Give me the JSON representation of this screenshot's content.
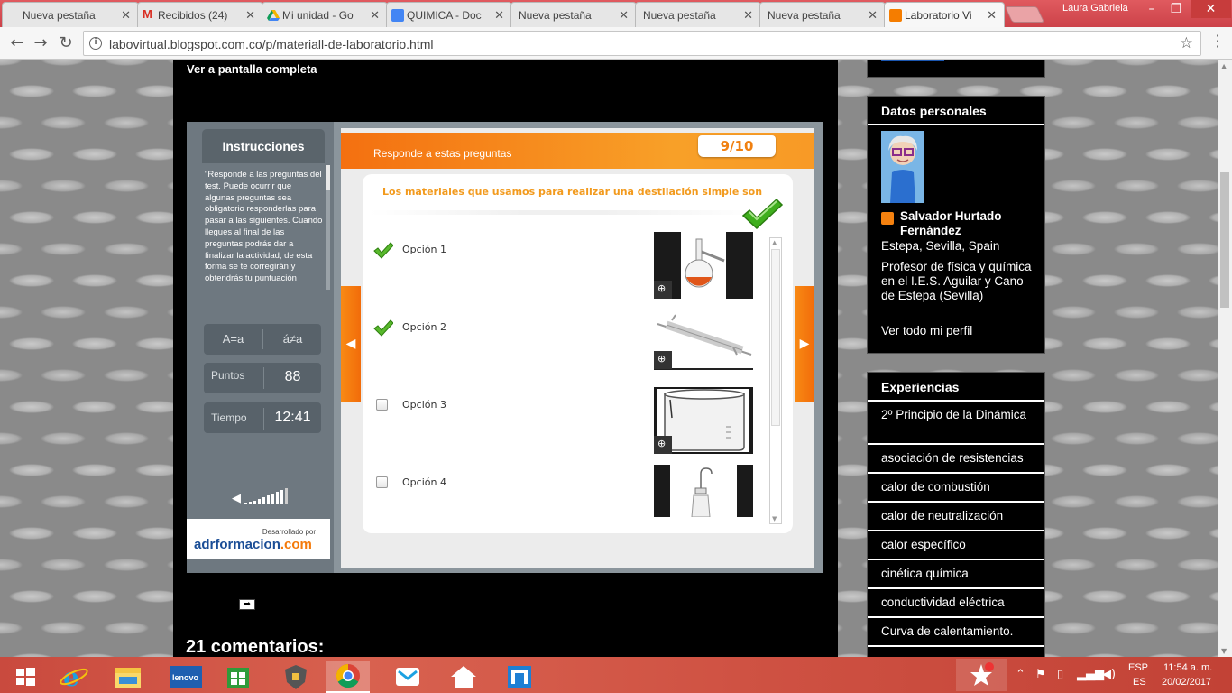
{
  "browser": {
    "tabs": [
      {
        "label": "Nueva pestaña",
        "icon": "blank-page-icon",
        "color": "#ffffff"
      },
      {
        "label": "Recibidos (24)",
        "icon": "gmail-icon",
        "color": "#d93025"
      },
      {
        "label": "Mi unidad - Go",
        "icon": "google-drive-icon",
        "color": "#f4b400"
      },
      {
        "label": "QUIMICA - Doc",
        "icon": "google-docs-icon",
        "color": "#4285f4"
      },
      {
        "label": "Nueva pestaña",
        "icon": "blank-page-icon",
        "color": "#ffffff"
      },
      {
        "label": "Nueva pestaña",
        "icon": "blank-page-icon",
        "color": "#ffffff"
      },
      {
        "label": "Nueva pestaña",
        "icon": "blank-page-icon",
        "color": "#ffffff"
      },
      {
        "label": "Laboratorio Vi",
        "icon": "blogger-icon",
        "color": "#f57d00"
      }
    ],
    "user": "Laura Gabriela",
    "url": "labovirtual.blogspot.com.co/p/materiall-de-laboratorio.html"
  },
  "page": {
    "fullscreen_link": "Ver a pantalla completa",
    "comments_heading": "21 comentarios:"
  },
  "quiz": {
    "instructions_title": "Instrucciones",
    "instructions_text": "\"Responde a las preguntas del test. Puede ocurrir que algunas preguntas sea obligatorio responderlas para pasar a las siguientes. Cuando llegues al final de las preguntas podrás dar a finalizar la actividad, de esta forma se te corregirán y obtendrás tu puntuación",
    "font_toggle_a": "A=a",
    "font_toggle_b": "á≠a",
    "points_label": "Puntos",
    "points_value": "88",
    "time_label": "Tiempo",
    "time_value": "12:41",
    "credit_small": "Desarrollado por",
    "credit_brand_main": "adrformacion",
    "credit_brand_suffix": ".com",
    "header_prompt": "Responde a estas preguntas",
    "counter": "9/10",
    "question": "Los materiales que usamos para realizar una destilación simple son",
    "options": [
      {
        "label": "Opción 1",
        "checked": true,
        "image": "round-bottom-flask"
      },
      {
        "label": "Opción 2",
        "checked": true,
        "image": "condenser"
      },
      {
        "label": "Opción 3",
        "checked": false,
        "image": "beaker"
      },
      {
        "label": "Opción 4",
        "checked": false,
        "image": "wash-bottle"
      }
    ],
    "accent_color": "#f47a0a"
  },
  "sidebar": {
    "profile_title": "Datos personales",
    "profile_name": "Salvador Hurtado Fernández",
    "profile_location": "Estepa, Sevilla, Spain",
    "profile_description": "Profesor de física y química en el I.E.S. Aguilar y Cano de Estepa (Sevilla)",
    "profile_link": "Ver todo mi perfil",
    "experiences_title": "Experiencias",
    "experiences": [
      "2º Principio de la Dinámica",
      "asociación de resistencias",
      "calor de combustión",
      "calor de neutralización",
      "calor específico",
      "cinética química",
      "conductividad eléctrica",
      "Curva de calentamiento."
    ]
  },
  "taskbar": {
    "language_top": "ESP",
    "language_bottom": "ES",
    "time": "11:54 a. m.",
    "date": "20/02/2017"
  }
}
